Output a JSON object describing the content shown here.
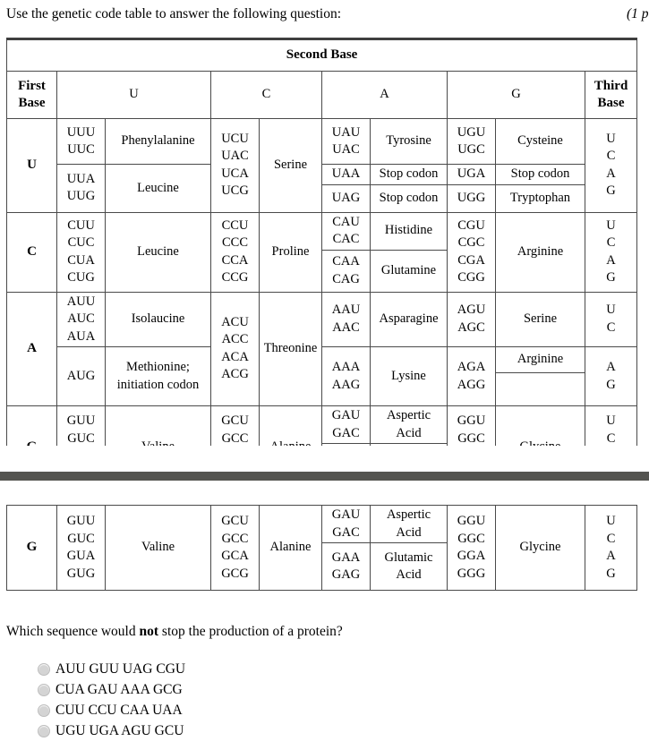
{
  "intro": {
    "instruction": "Use the genetic code table to answer the following question:",
    "points": "(1 p"
  },
  "table": {
    "title": "Second Base",
    "first_base_header": "First\nBase",
    "third_base_header": "Third\nBase",
    "second_base_columns": [
      "U",
      "C",
      "A",
      "G"
    ],
    "rows": [
      {
        "first_base": "U",
        "third_base": "U\nC\nA\nG",
        "u": [
          {
            "codons": "UUU\nUUC",
            "amino": "Phenylalanine"
          },
          {
            "codons": "UUA\nUUG",
            "amino": "Leucine"
          }
        ],
        "c": [
          {
            "codons": "UCU\nUAC\nUCA\nUCG",
            "amino": "Serine"
          }
        ],
        "a": [
          {
            "codons": "UAU\nUAC",
            "amino": "Tyrosine"
          },
          {
            "codons": "UAA",
            "amino": "Stop codon"
          },
          {
            "codons": "UAG",
            "amino": "Stop codon"
          }
        ],
        "g": [
          {
            "codons": "UGU\nUGC",
            "amino": "Cysteine"
          },
          {
            "codons": "UGA",
            "amino": "Stop codon"
          },
          {
            "codons": "UGG",
            "amino": "Tryptophan"
          }
        ]
      },
      {
        "first_base": "C",
        "third_base": "U\nC\nA\nG",
        "u": [
          {
            "codons": "CUU\nCUC\nCUA\nCUG",
            "amino": "Leucine"
          }
        ],
        "c": [
          {
            "codons": "CCU\nCCC\nCCA\nCCG",
            "amino": "Proline"
          }
        ],
        "a": [
          {
            "codons": "CAU\nCAC",
            "amino": "Histidine"
          },
          {
            "codons": "CAA\nCAG",
            "amino": "Glutamine"
          }
        ],
        "g": [
          {
            "codons": "CGU\nCGC\nCGA\nCGG",
            "amino": "Arginine"
          }
        ]
      },
      {
        "first_base": "A",
        "third_base_top": "U\nC",
        "third_base_bottom": "A\nG",
        "u": [
          {
            "codons": "AUU\nAUC\nAUA",
            "amino": "Isolaucine"
          },
          {
            "codons": "AUG",
            "amino": "Methionine;\ninitiation codon"
          }
        ],
        "c": [
          {
            "codons": "ACU\nACC\nACA\nACG",
            "amino": "Threonine"
          }
        ],
        "a": [
          {
            "codons": "AAU\nAAC",
            "amino": "Asparagine"
          },
          {
            "codons": "AAA\nAAG",
            "amino": "Lysine"
          }
        ],
        "g": [
          {
            "codons": "AGU\nAGC",
            "amino": "Serine"
          },
          {
            "codons": "AGA\nAGG",
            "amino": "Arginine"
          },
          {
            "codons": "",
            "amino": ""
          }
        ]
      },
      {
        "first_base": "G",
        "third_base": "U\nC\nA\nG",
        "u": [
          {
            "codons": "GUU\nGUC\nGUA\nGUG",
            "amino": "Valine"
          }
        ],
        "c": [
          {
            "codons": "GCU\nGCC\nGCA\nGCG",
            "amino": "Alanine"
          }
        ],
        "a": [
          {
            "codons": "GAU\nGAC",
            "amino": "Aspertic\nAcid"
          },
          {
            "codons": "GAA\nGAG",
            "amino": "Glutamic\nAcid"
          }
        ],
        "g": [
          {
            "codons": "GGU\nGGC\nGGA\nGGG",
            "amino": "Glycine"
          }
        ]
      }
    ]
  },
  "question": {
    "prefix": "Which sequence would ",
    "emphasis": "not",
    "suffix": " stop the production of a protein?",
    "options": [
      {
        "label": "AUU GUU UAG CGU",
        "selected": false
      },
      {
        "label": "CUA GAU AAA GCG",
        "selected": false
      },
      {
        "label": "CUU CCU CAA UAA",
        "selected": false
      },
      {
        "label": "UGU UGA AGU GCU",
        "selected": false
      }
    ]
  },
  "colors": {
    "separator_bar": "#545450",
    "table_border": "#4a4a4a",
    "radio_fill": "#d4d4d4"
  }
}
